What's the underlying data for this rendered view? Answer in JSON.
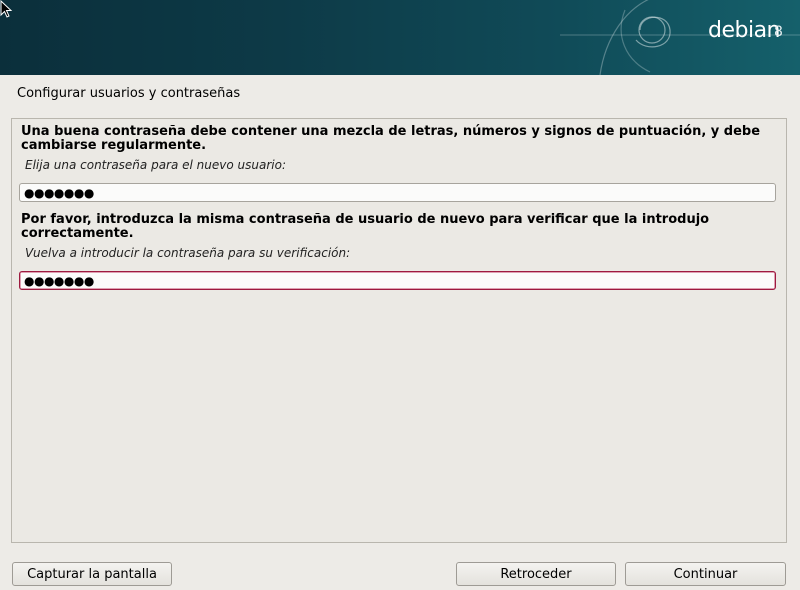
{
  "banner": {
    "logo_text": "debian",
    "logo_version": "8",
    "swirl_icon": "debian-swirl-icon",
    "cursor_icon": "mouse-pointer-icon",
    "colors": {
      "dark": "#0b2f3b",
      "light": "#15606b"
    }
  },
  "step_title": "Configurar usuarios y contraseñas",
  "form": {
    "password_description": "Una buena contraseña debe contener una mezcla de letras, números y signos de puntuación, y debe cambiarse regularmente.",
    "password_prompt": "Elija una contraseña para el nuevo usuario:",
    "password_value": "●●●●●●●",
    "verify_description": "Por favor, introduzca la misma contraseña de usuario de nuevo para verificar que la introdujo correctamente.",
    "verify_prompt": "Vuelva a introducir la contraseña para su verificación:",
    "verify_value": "●●●●●●●",
    "focus_color": "#9d1a3f"
  },
  "buttons": {
    "screenshot": "Capturar la pantalla",
    "back": "Retroceder",
    "continue": "Continuar"
  }
}
